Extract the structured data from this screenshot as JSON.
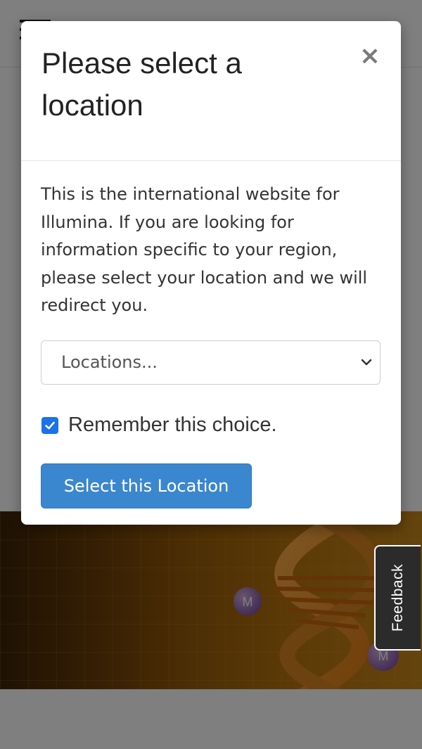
{
  "modal": {
    "title": "Please select a location",
    "close_label": "×",
    "body_text": "This is the international website for Illumina. If you are looking for information specific to your region, please select your location and we will redirect you.",
    "location_select": {
      "selected": "Locations..."
    },
    "remember": {
      "checked": true,
      "label": "Remember this choice."
    },
    "submit_label": "Select this Location"
  },
  "feedback": {
    "label": "Feedback"
  },
  "hero": {
    "molecule_labels": [
      "M",
      "M"
    ]
  },
  "colors": {
    "primary_button": "#3b87cf",
    "checkbox": "#1a73e8",
    "backdrop": "rgba(0,0,0,0.5)",
    "feedback_bg": "#2b2b2b"
  }
}
